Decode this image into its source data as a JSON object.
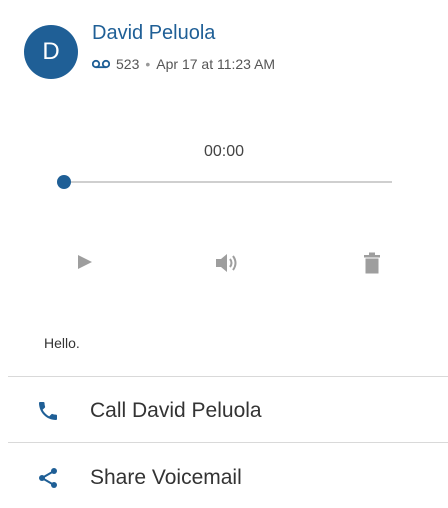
{
  "contact": {
    "initial": "D",
    "name": "David Peluola",
    "extension": "523",
    "separator": "•",
    "datetime": "Apr 17 at 11:23 AM"
  },
  "player": {
    "time": "00:00",
    "progress": 0
  },
  "icons": {
    "voicemail": "voicemail-icon",
    "play": "play-icon",
    "volume": "volume-icon",
    "delete": "trash-icon",
    "phone": "phone-icon",
    "share": "share-icon"
  },
  "transcript": "Hello.",
  "actions": {
    "call_label": "Call David Peluola",
    "share_label": "Share Voicemail"
  },
  "colors": {
    "accent": "#1f5f96",
    "icon_gray": "#9e9e9e"
  }
}
